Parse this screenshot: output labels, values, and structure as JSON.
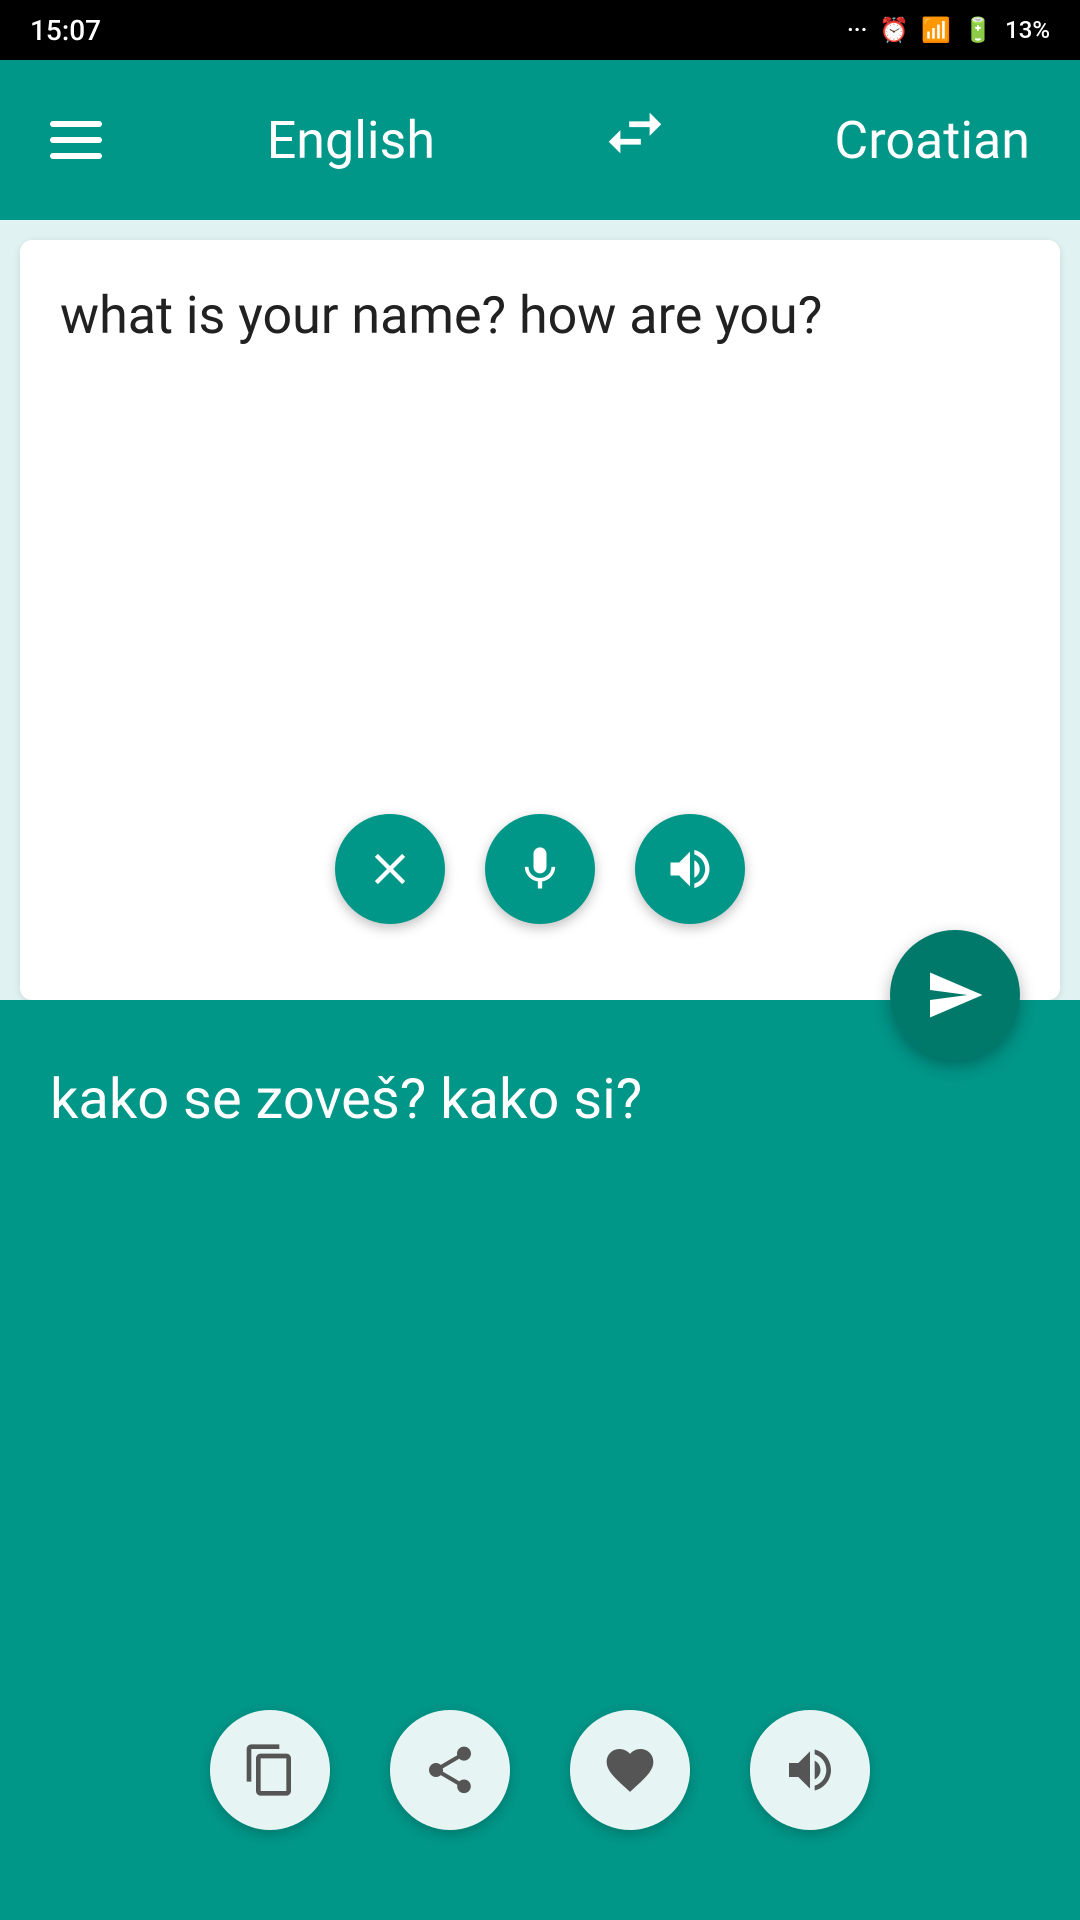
{
  "statusBar": {
    "time": "15:07",
    "battery": "13%"
  },
  "toolbar": {
    "menu_label": "menu",
    "source_lang": "English",
    "target_lang": "Croatian"
  },
  "inputPanel": {
    "text": "what is your name? how are you?",
    "clearBtn": "clear",
    "micBtn": "microphone",
    "speakBtn": "speak input"
  },
  "sendButton": {
    "label": "translate"
  },
  "outputPanel": {
    "text": "kako se zoveš? kako si?",
    "copyBtn": "copy",
    "shareBtn": "share",
    "favoriteBtn": "favorite",
    "speakBtn": "speak output"
  }
}
